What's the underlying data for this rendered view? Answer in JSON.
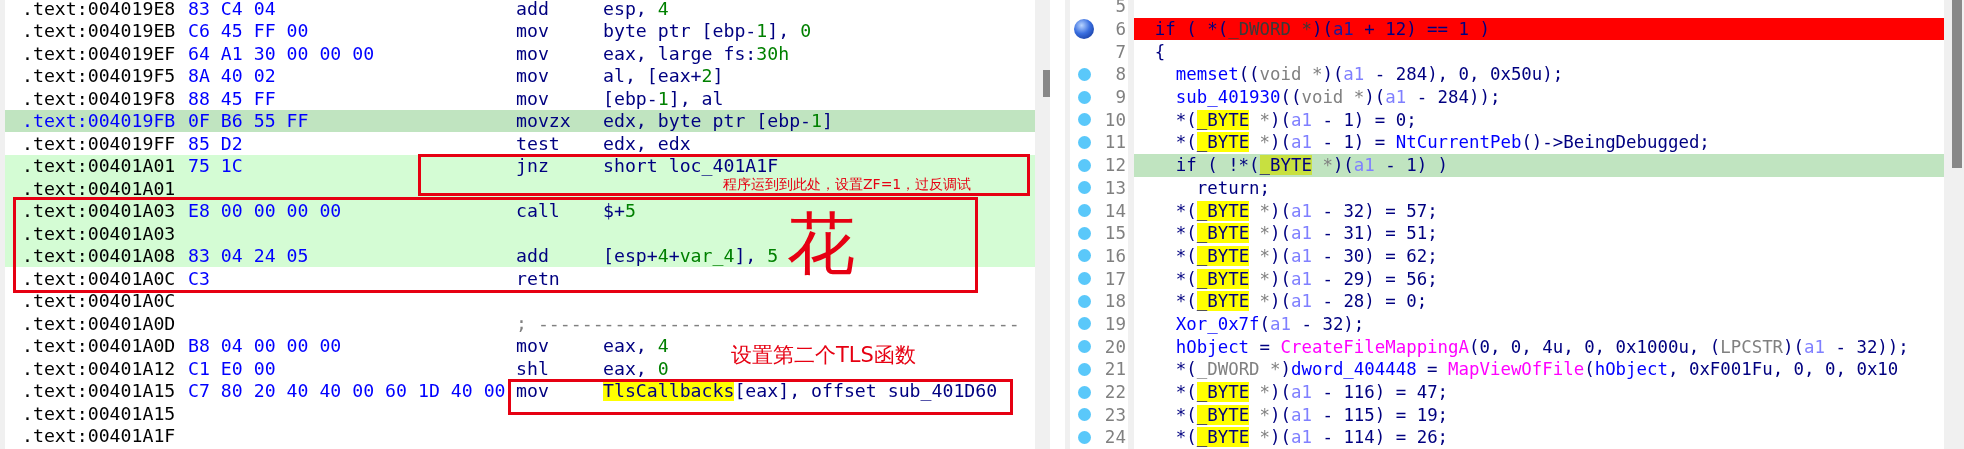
{
  "disasm": {
    "rows": [
      {
        "address": ".text:004019E8",
        "bytes": "83 C4 04",
        "mnemonic": "add",
        "operands": [
          {
            "kind": "p",
            "text": "esp, "
          },
          {
            "kind": "n",
            "text": "4"
          }
        ],
        "selected": false,
        "highlighted": false
      },
      {
        "address": ".text:004019EB",
        "bytes": "C6 45 FF 00",
        "mnemonic": "mov",
        "operands": [
          {
            "kind": "p",
            "text": "byte ptr [ebp-"
          },
          {
            "kind": "n",
            "text": "1"
          },
          {
            "kind": "p",
            "text": "], "
          },
          {
            "kind": "n",
            "text": "0"
          }
        ],
        "selected": false,
        "highlighted": false
      },
      {
        "address": ".text:004019EF",
        "bytes": "64 A1 30 00 00 00",
        "mnemonic": "mov",
        "operands": [
          {
            "kind": "p",
            "text": "eax, large fs:"
          },
          {
            "kind": "n",
            "text": "30h"
          }
        ],
        "selected": false,
        "highlighted": false
      },
      {
        "address": ".text:004019F5",
        "bytes": "8A 40 02",
        "mnemonic": "mov",
        "operands": [
          {
            "kind": "p",
            "text": "al, [eax+"
          },
          {
            "kind": "n",
            "text": "2"
          },
          {
            "kind": "p",
            "text": "]"
          }
        ],
        "selected": false,
        "highlighted": false
      },
      {
        "address": ".text:004019F8",
        "bytes": "88 45 FF",
        "mnemonic": "mov",
        "operands": [
          {
            "kind": "p",
            "text": "[ebp-"
          },
          {
            "kind": "n",
            "text": "1"
          },
          {
            "kind": "p",
            "text": "], al"
          }
        ],
        "selected": false,
        "highlighted": false
      },
      {
        "address": ".text:004019FB",
        "bytes": "0F B6 55 FF",
        "mnemonic": "movzx",
        "operands": [
          {
            "kind": "p",
            "text": "edx, byte ptr [ebp-"
          },
          {
            "kind": "n",
            "text": "1"
          },
          {
            "kind": "p",
            "text": "]"
          }
        ],
        "selected": true,
        "highlighted": false
      },
      {
        "address": ".text:004019FF",
        "bytes": "85 D2",
        "mnemonic": "test",
        "operands": [
          {
            "kind": "p",
            "text": "edx, edx"
          }
        ],
        "selected": false,
        "highlighted": false
      },
      {
        "address": ".text:00401A01",
        "bytes": "75 1C",
        "mnemonic": "jnz",
        "operands": [
          {
            "kind": "p",
            "text": "short loc_401A1F"
          }
        ],
        "selected": false,
        "highlighted": true
      },
      {
        "address": ".text:00401A01",
        "selected": false,
        "highlighted": true
      },
      {
        "address": ".text:00401A03",
        "bytes": "E8 00 00 00 00",
        "mnemonic": "call",
        "operands": [
          {
            "kind": "p",
            "text": "$+"
          },
          {
            "kind": "n",
            "text": "5"
          }
        ],
        "selected": false,
        "highlighted": true
      },
      {
        "address": ".text:00401A03",
        "selected": false,
        "highlighted": true
      },
      {
        "address": ".text:00401A08",
        "bytes": "83 04 24 05",
        "mnemonic": "add",
        "operands": [
          {
            "kind": "p",
            "text": "[esp+"
          },
          {
            "kind": "n",
            "text": "4"
          },
          {
            "kind": "p",
            "text": "+"
          },
          {
            "kind": "n",
            "text": "var_4"
          },
          {
            "kind": "p",
            "text": "], "
          },
          {
            "kind": "n",
            "text": "5"
          }
        ],
        "selected": false,
        "highlighted": true
      },
      {
        "address": ".text:00401A0C",
        "bytes": "C3",
        "mnemonic": "retn",
        "selected": false,
        "highlighted": false
      },
      {
        "address": ".text:00401A0C",
        "selected": false,
        "highlighted": false
      },
      {
        "address": ".text:00401A0D",
        "comment": "; --------------------------------------------",
        "selected": false,
        "highlighted": false
      },
      {
        "address": ".text:00401A0D",
        "bytes": "B8 04 00 00 00",
        "mnemonic": "mov",
        "operands": [
          {
            "kind": "p",
            "text": "eax, "
          },
          {
            "kind": "n",
            "text": "4"
          }
        ],
        "selected": false,
        "highlighted": false
      },
      {
        "address": ".text:00401A12",
        "bytes": "C1 E0 00",
        "mnemonic": "shl",
        "operands": [
          {
            "kind": "p",
            "text": "eax, "
          },
          {
            "kind": "n",
            "text": "0"
          }
        ],
        "selected": false,
        "highlighted": false
      },
      {
        "address": ".text:00401A15",
        "bytes": "C7 80 20 40 40 00 60 1D 40 00",
        "mnemonic": "mov",
        "operands": [
          {
            "kind": "hl",
            "text": "TlsCallbacks"
          },
          {
            "kind": "p",
            "text": "[eax], offset sub_401D60"
          }
        ],
        "selected": false,
        "highlighted": false
      },
      {
        "address": ".text:00401A15",
        "selected": false,
        "highlighted": false
      },
      {
        "address": ".text:00401A1F",
        "selected": false,
        "highlighted": false
      }
    ]
  },
  "notes": [
    {
      "kind": "small",
      "text": "程序运到到此处，设置ZF=1，过反调试"
    },
    {
      "kind": "big",
      "text": "花"
    },
    {
      "kind": "medium",
      "text": "设置第二个TLS函数"
    }
  ],
  "pseudocode": {
    "lines": [
      {
        "number": "5",
        "breakpoint": false,
        "hit": false,
        "selected": false
      },
      {
        "number": "6",
        "breakpoint": true,
        "hit": true,
        "selected": false,
        "tokens": [
          {
            "kind": "p",
            "text": "if ( *("
          },
          {
            "kind": "t",
            "text": "_DWORD *"
          },
          {
            "kind": "p",
            "text": ")("
          },
          {
            "kind": "v",
            "text": "a1"
          },
          {
            "kind": "p",
            "text": " + 12) == 1 )"
          }
        ]
      },
      {
        "number": "7",
        "breakpoint": false,
        "hit": false,
        "selected": false,
        "tokens": [
          {
            "kind": "p",
            "text": "{"
          }
        ],
        "children": [
          {
            "number": "8",
            "breakpoint": true,
            "hit": false,
            "selected": false,
            "tokens": [
              {
                "kind": "f",
                "text": "memset"
              },
              {
                "kind": "p",
                "text": "(("
              },
              {
                "kind": "t",
                "text": "void *"
              },
              {
                "kind": "p",
                "text": ")("
              },
              {
                "kind": "v",
                "text": "a1"
              },
              {
                "kind": "p",
                "text": " - 284), 0, 0x50u);"
              }
            ]
          },
          {
            "number": "9",
            "breakpoint": true,
            "hit": false,
            "selected": false,
            "tokens": [
              {
                "kind": "f",
                "text": "sub_401930"
              },
              {
                "kind": "p",
                "text": "(("
              },
              {
                "kind": "t",
                "text": "void *"
              },
              {
                "kind": "p",
                "text": ")("
              },
              {
                "kind": "v",
                "text": "a1"
              },
              {
                "kind": "p",
                "text": " - 284));"
              }
            ]
          },
          {
            "number": "10",
            "breakpoint": true,
            "hit": false,
            "selected": false,
            "tokens": [
              {
                "kind": "p",
                "text": "*("
              },
              {
                "kind": "hl",
                "text": "_BYTE"
              },
              {
                "kind": "t",
                "text": " *"
              },
              {
                "kind": "p",
                "text": ")("
              },
              {
                "kind": "v",
                "text": "a1"
              },
              {
                "kind": "p",
                "text": " - 1) = 0;"
              }
            ]
          },
          {
            "number": "11",
            "breakpoint": true,
            "hit": false,
            "selected": false,
            "tokens": [
              {
                "kind": "p",
                "text": "*("
              },
              {
                "kind": "hl",
                "text": "_BYTE"
              },
              {
                "kind": "t",
                "text": " *"
              },
              {
                "kind": "p",
                "text": ")("
              },
              {
                "kind": "v",
                "text": "a1"
              },
              {
                "kind": "p",
                "text": " - 1) = "
              },
              {
                "kind": "f",
                "text": "NtCurrentPeb"
              },
              {
                "kind": "p",
                "text": "()->BeingDebugged;"
              }
            ]
          },
          {
            "number": "12",
            "breakpoint": true,
            "hit": false,
            "selected": true,
            "tokens": [
              {
                "kind": "p",
                "text": "if ( !*("
              },
              {
                "kind": "hl",
                "text": "_BYTE"
              },
              {
                "kind": "t",
                "text": " *"
              },
              {
                "kind": "p",
                "text": ")("
              },
              {
                "kind": "v",
                "text": "a1"
              },
              {
                "kind": "p",
                "text": " - 1) )"
              }
            ],
            "children": [
              {
                "number": "13",
                "breakpoint": true,
                "hit": false,
                "selected": false,
                "tokens": [
                  {
                    "kind": "p",
                    "text": "return;"
                  }
                ]
              }
            ]
          },
          {
            "number": "14",
            "breakpoint": true,
            "hit": false,
            "selected": false,
            "tokens": [
              {
                "kind": "p",
                "text": "*("
              },
              {
                "kind": "hl",
                "text": "_BYTE"
              },
              {
                "kind": "t",
                "text": " *"
              },
              {
                "kind": "p",
                "text": ")("
              },
              {
                "kind": "v",
                "text": "a1"
              },
              {
                "kind": "p",
                "text": " - 32) = 57;"
              }
            ]
          },
          {
            "number": "15",
            "breakpoint": true,
            "hit": false,
            "selected": false,
            "tokens": [
              {
                "kind": "p",
                "text": "*("
              },
              {
                "kind": "hl",
                "text": "_BYTE"
              },
              {
                "kind": "t",
                "text": " *"
              },
              {
                "kind": "p",
                "text": ")("
              },
              {
                "kind": "v",
                "text": "a1"
              },
              {
                "kind": "p",
                "text": " - 31) = 51;"
              }
            ]
          },
          {
            "number": "16",
            "breakpoint": true,
            "hit": false,
            "selected": false,
            "tokens": [
              {
                "kind": "p",
                "text": "*("
              },
              {
                "kind": "hl",
                "text": "_BYTE"
              },
              {
                "kind": "t",
                "text": " *"
              },
              {
                "kind": "p",
                "text": ")("
              },
              {
                "kind": "v",
                "text": "a1"
              },
              {
                "kind": "p",
                "text": " - 30) = 62;"
              }
            ]
          },
          {
            "number": "17",
            "breakpoint": true,
            "hit": false,
            "selected": false,
            "tokens": [
              {
                "kind": "p",
                "text": "*("
              },
              {
                "kind": "hl",
                "text": "_BYTE"
              },
              {
                "kind": "t",
                "text": " *"
              },
              {
                "kind": "p",
                "text": ")("
              },
              {
                "kind": "v",
                "text": "a1"
              },
              {
                "kind": "p",
                "text": " - 29) = 56;"
              }
            ]
          },
          {
            "number": "18",
            "breakpoint": true,
            "hit": false,
            "selected": false,
            "tokens": [
              {
                "kind": "p",
                "text": "*("
              },
              {
                "kind": "hl",
                "text": "_BYTE"
              },
              {
                "kind": "t",
                "text": " *"
              },
              {
                "kind": "p",
                "text": ")("
              },
              {
                "kind": "v",
                "text": "a1"
              },
              {
                "kind": "p",
                "text": " - 28) = 0;"
              }
            ]
          },
          {
            "number": "19",
            "breakpoint": true,
            "hit": false,
            "selected": false,
            "tokens": [
              {
                "kind": "f",
                "text": "Xor_0x7f"
              },
              {
                "kind": "p",
                "text": "("
              },
              {
                "kind": "v",
                "text": "a1"
              },
              {
                "kind": "p",
                "text": " - 32);"
              }
            ]
          },
          {
            "number": "20",
            "breakpoint": true,
            "hit": false,
            "selected": false,
            "tokens": [
              {
                "kind": "f",
                "text": "hObject"
              },
              {
                "kind": "p",
                "text": " = "
              },
              {
                "kind": "i",
                "text": "CreateFileMappingA"
              },
              {
                "kind": "p",
                "text": "(0, 0, 4u, 0, 0x1000u, ("
              },
              {
                "kind": "t",
                "text": "LPCSTR"
              },
              {
                "kind": "p",
                "text": ")("
              },
              {
                "kind": "v",
                "text": "a1"
              },
              {
                "kind": "p",
                "text": " - 32));"
              }
            ]
          },
          {
            "number": "21",
            "breakpoint": true,
            "hit": false,
            "selected": false,
            "tokens": [
              {
                "kind": "p",
                "text": "*("
              },
              {
                "kind": "t",
                "text": "_DWORD *"
              },
              {
                "kind": "p",
                "text": ")"
              },
              {
                "kind": "f",
                "text": "dword_404448"
              },
              {
                "kind": "p",
                "text": " = "
              },
              {
                "kind": "i",
                "text": "MapViewOfFile"
              },
              {
                "kind": "p",
                "text": "("
              },
              {
                "kind": "f",
                "text": "hObject"
              },
              {
                "kind": "p",
                "text": ", 0xF001Fu, 0, 0, 0x10"
              }
            ]
          },
          {
            "number": "22",
            "breakpoint": true,
            "hit": false,
            "selected": false,
            "tokens": [
              {
                "kind": "p",
                "text": "*("
              },
              {
                "kind": "hl",
                "text": "_BYTE"
              },
              {
                "kind": "t",
                "text": " *"
              },
              {
                "kind": "p",
                "text": ")("
              },
              {
                "kind": "v",
                "text": "a1"
              },
              {
                "kind": "p",
                "text": " - 116) = 47;"
              }
            ]
          },
          {
            "number": "23",
            "breakpoint": true,
            "hit": false,
            "selected": false,
            "tokens": [
              {
                "kind": "p",
                "text": "*("
              },
              {
                "kind": "hl",
                "text": "_BYTE"
              },
              {
                "kind": "t",
                "text": " *"
              },
              {
                "kind": "p",
                "text": ")("
              },
              {
                "kind": "v",
                "text": "a1"
              },
              {
                "kind": "p",
                "text": " - 115) = 19;"
              }
            ]
          },
          {
            "number": "24",
            "breakpoint": true,
            "hit": false,
            "selected": false,
            "tokens": [
              {
                "kind": "p",
                "text": "*("
              },
              {
                "kind": "hl",
                "text": "_BYTE"
              },
              {
                "kind": "t",
                "text": " *"
              },
              {
                "kind": "p",
                "text": ")("
              },
              {
                "kind": "v",
                "text": "a1"
              },
              {
                "kind": "p",
                "text": " - 114) = 26;"
              }
            ]
          }
        ]
      }
    ]
  }
}
